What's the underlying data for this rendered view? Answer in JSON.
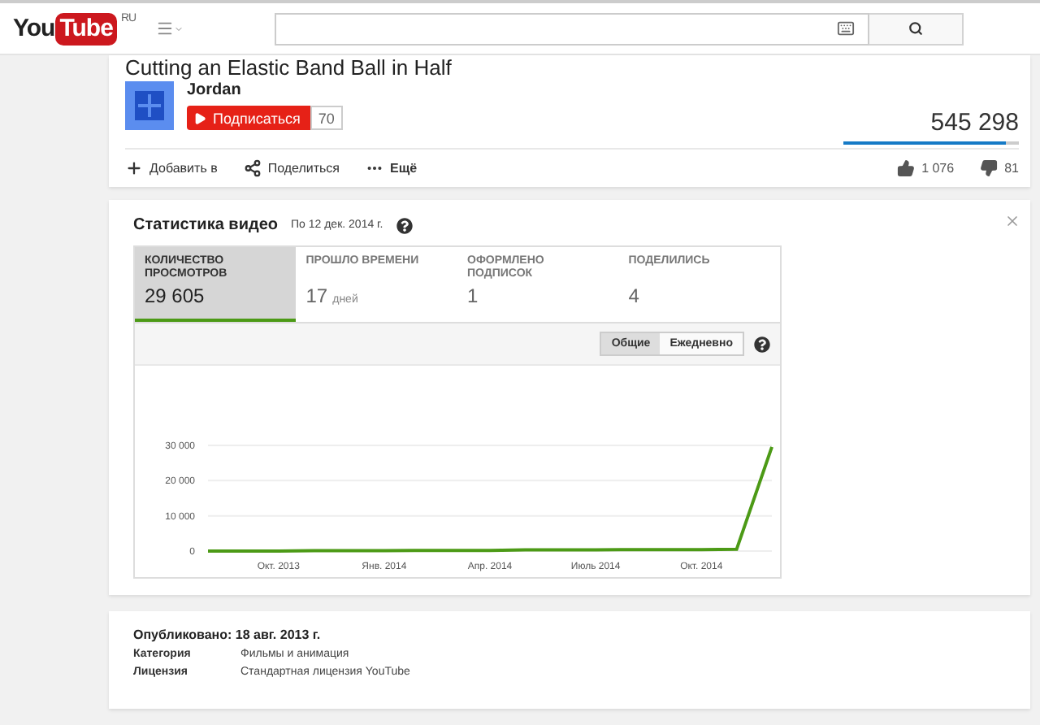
{
  "header": {
    "logo": {
      "text_1": "You",
      "text_2": "Tube",
      "region": "RU"
    }
  },
  "video": {
    "title": "Cutting an Elastic Band Ball in Half",
    "channel": "Jordan",
    "subscribe": "Подписаться",
    "subscribers": "70",
    "views": "545 298",
    "like_bar": {
      "level": 0.93
    },
    "actions": [
      {
        "kind": "add",
        "label": "Добавить в"
      },
      {
        "kind": "share",
        "label": "Поделиться"
      },
      {
        "kind": "more",
        "label": "Ещё"
      }
    ],
    "likes": "1 076",
    "dislikes": "81"
  },
  "stats": {
    "title": "Статистика видео",
    "date": "По 12 дек. 2014 г.",
    "metrics": [
      {
        "label": "КОЛИЧЕСТВО ПРОСМОТРОВ",
        "value": "29 605",
        "selected": true
      },
      {
        "label": "ПРОШЛО ВРЕМЕНИ",
        "value": "17",
        "unit": "дней",
        "selected": false
      },
      {
        "label": "ОФОРМЛЕНО ПОДПИСОК",
        "value": "1",
        "selected": false
      },
      {
        "label": "ПОДЕЛИЛИСЬ",
        "value": "4",
        "selected": false
      }
    ],
    "modes": [
      {
        "label": "Общие",
        "selected": true
      },
      {
        "label": "Ежедневно",
        "selected": false
      }
    ],
    "chart_data": {
      "type": "line",
      "categories": [
        null,
        null,
        "Окт. 2013",
        null,
        null,
        "Янв. 2014",
        null,
        null,
        "Апр. 2014",
        null,
        null,
        "Июль 2014",
        null,
        null,
        "Окт. 2014",
        null,
        null
      ],
      "series": [
        {
          "color": "#4c9a16",
          "values": [
            0,
            0,
            0,
            100,
            100,
            100,
            200,
            200,
            200,
            300,
            300,
            300,
            400,
            400,
            400,
            500,
            29600
          ]
        }
      ],
      "ylim": [
        0,
        30000
      ],
      "yticks": [
        {
          "value": 0,
          "label": "0"
        },
        {
          "value": 10000,
          "label": "10 000"
        },
        {
          "value": 20000,
          "label": "20 000"
        },
        {
          "value": 30000,
          "label": "30 000"
        }
      ]
    }
  },
  "details": {
    "published": "Опубликовано: 18 авг. 2013 г.",
    "rows": [
      {
        "label": "Категория",
        "value": "Фильмы и анимация"
      },
      {
        "label": "Лицензия",
        "value": "Стандартная лицензия YouTube"
      }
    ]
  }
}
